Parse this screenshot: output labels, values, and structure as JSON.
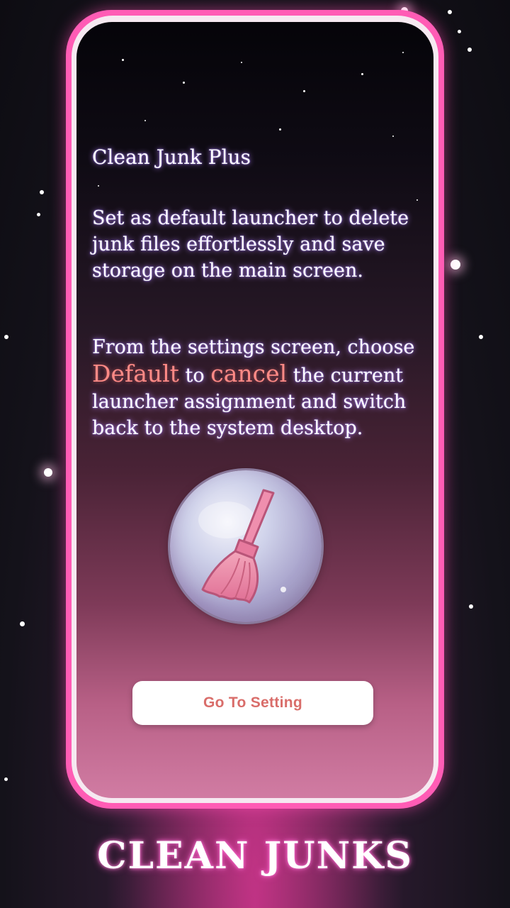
{
  "screen": {
    "title": "Clean Junk Plus",
    "paragraph1": "Set as default launcher to delete junk files effortlessly and save storage on the main screen.",
    "paragraph2_start": "From the settings screen, choose ",
    "paragraph2_highlight1": "Default",
    "paragraph2_middle": " to ",
    "paragraph2_highlight2": "cancel",
    "paragraph2_end": " the current launcher assignment and switch back to the system desktop.",
    "illustration_icon": "broom-icon",
    "button_label": "Go To Setting"
  },
  "banner": {
    "text": "CLEAN JUNKS"
  },
  "colors": {
    "frame": "#ff5cb5",
    "highlight": "#ff8a86",
    "button_text": "#d96d6a"
  }
}
